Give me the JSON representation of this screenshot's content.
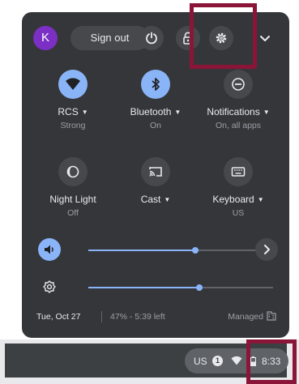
{
  "header": {
    "avatar_initial": "K",
    "sign_out_label": "Sign out",
    "icons": [
      "power-icon",
      "lock-icon",
      "settings-icon",
      "chevron-down-icon"
    ]
  },
  "tiles": [
    {
      "label": "RCS",
      "sub": "Strong",
      "icon": "wifi-icon",
      "active": true
    },
    {
      "label": "Bluetooth",
      "sub": "On",
      "icon": "bluetooth-icon",
      "active": true
    },
    {
      "label": "Notifications",
      "sub": "On, all apps",
      "icon": "do-not-disturb-icon",
      "active": false
    },
    {
      "label": "Night Light",
      "sub": "Off",
      "icon": "night-light-icon",
      "active": false
    },
    {
      "label": "Cast",
      "sub": "",
      "icon": "cast-icon",
      "active": false
    },
    {
      "label": "Keyboard",
      "sub": "US",
      "icon": "keyboard-icon",
      "active": false
    }
  ],
  "sliders": {
    "volume": {
      "level": 0.58,
      "icon": "volume-icon"
    },
    "brightness": {
      "level": 0.6,
      "icon": "brightness-icon"
    }
  },
  "footer": {
    "date": "Tue, Oct 27",
    "battery": "47% - 5:39 left",
    "managed": "Managed"
  },
  "shelf": {
    "ime": "US",
    "notification_count": "1",
    "time": "8:33"
  },
  "colors": {
    "panel": "#35363a",
    "accent": "#8ab4f8",
    "highlight": "#8a1538"
  }
}
